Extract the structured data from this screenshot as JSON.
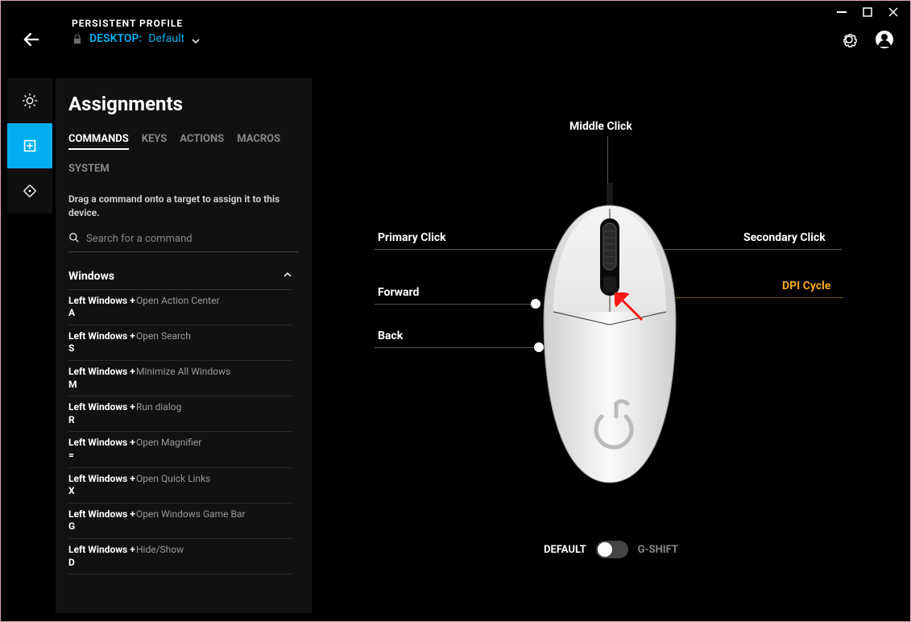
{
  "header": {
    "profile_label": "PERSISTENT PROFILE",
    "profile_prefix": "DESKTOP:",
    "profile_name": "Default"
  },
  "panel": {
    "title": "Assignments",
    "tabs": [
      "COMMANDS",
      "KEYS",
      "ACTIONS",
      "MACROS",
      "SYSTEM"
    ],
    "active_tab": "COMMANDS",
    "hint": "Drag a command onto a target to assign it to this device.",
    "search_placeholder": "Search for a command"
  },
  "commands": {
    "group": "Windows",
    "items": [
      {
        "key": "Left Windows + A",
        "desc": "Open Action Center"
      },
      {
        "key": "Left Windows + S",
        "desc": "Open Search"
      },
      {
        "key": "Left Windows + M",
        "desc": "Minimize All Windows"
      },
      {
        "key": "Left Windows + R",
        "desc": "Run dialog"
      },
      {
        "key": "Left Windows + =",
        "desc": "Open Magnifier"
      },
      {
        "key": "Left Windows + X",
        "desc": "Open Quick Links"
      },
      {
        "key": "Left Windows + G",
        "desc": "Open Windows Game Bar"
      },
      {
        "key": "Left Windows + D",
        "desc": "Hide/Show"
      }
    ]
  },
  "canvas": {
    "labels": {
      "middle": "Middle Click",
      "primary": "Primary Click",
      "secondary": "Secondary Click",
      "forward": "Forward",
      "back": "Back",
      "dpi": "DPI Cycle"
    },
    "mode_default": "DEFAULT",
    "mode_gshift": "G-SHIFT"
  }
}
